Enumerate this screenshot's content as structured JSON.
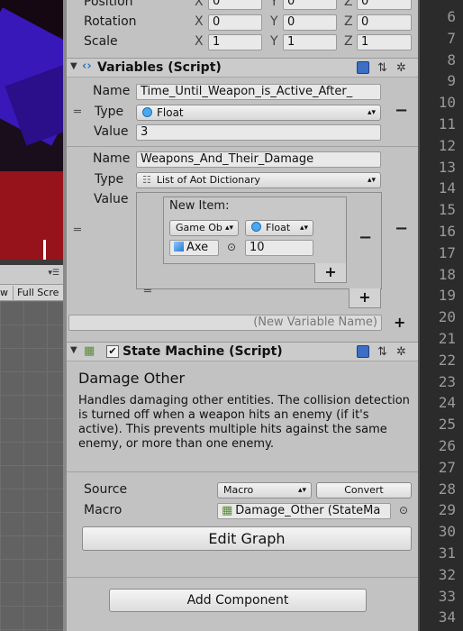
{
  "game_view": {
    "menu_icon": "dropdown-menu-icon",
    "tabs": [
      "w",
      "Full Scre"
    ]
  },
  "transform": {
    "rows": [
      {
        "label": "Position",
        "x": "0",
        "y": "0",
        "z": "0"
      },
      {
        "label": "Rotation",
        "x": "0",
        "y": "0",
        "z": "0"
      },
      {
        "label": "Scale",
        "x": "1",
        "y": "1",
        "z": "1"
      }
    ],
    "axis": {
      "x": "X",
      "y": "Y",
      "z": "Z"
    }
  },
  "variables": {
    "title": "Variables (Script)",
    "labels": {
      "name": "Name",
      "type": "Type",
      "value": "Value"
    },
    "var1": {
      "name": "Time_Until_Weapon_is_Active_After_",
      "type": "Float",
      "value": "3"
    },
    "var2": {
      "name": "Weapons_And_Their_Damage",
      "type": "List of Aot Dictionary",
      "new_item_label": "New Item:",
      "key_type": "Game Ob",
      "value_type": "Float",
      "key_value": "Axe",
      "item_value": "10"
    },
    "new_variable_placeholder": "(New Variable Name)",
    "plus": "+",
    "minus": "−"
  },
  "state_machine": {
    "title": "State Machine (Script)",
    "graph_title": "Damage Other",
    "description": "Handles damaging other entities. The collision detection is turned off when a weapon hits an enemy (if it's active). This prevents multiple hits against the same enemy, or more than one enemy.",
    "source_label": "Source",
    "source_value": "Macro",
    "convert_label": "Convert",
    "macro_label": "Macro",
    "macro_value": "Damage_Other (StateMa",
    "edit_graph_label": "Edit Graph"
  },
  "add_component_label": "Add Component",
  "line_numbers": [
    "6",
    "7",
    "8",
    "9",
    "10",
    "11",
    "12",
    "13",
    "14",
    "15",
    "16",
    "17",
    "18",
    "19",
    "20",
    "21",
    "22",
    "23",
    "24",
    "25",
    "26",
    "27",
    "28",
    "29",
    "30",
    "31",
    "32",
    "33",
    "34"
  ],
  "colors": {
    "float_dot": "#4aa8f0",
    "panel_bg": "#c2c2c2",
    "gutter_bg": "#2b2b2b"
  }
}
